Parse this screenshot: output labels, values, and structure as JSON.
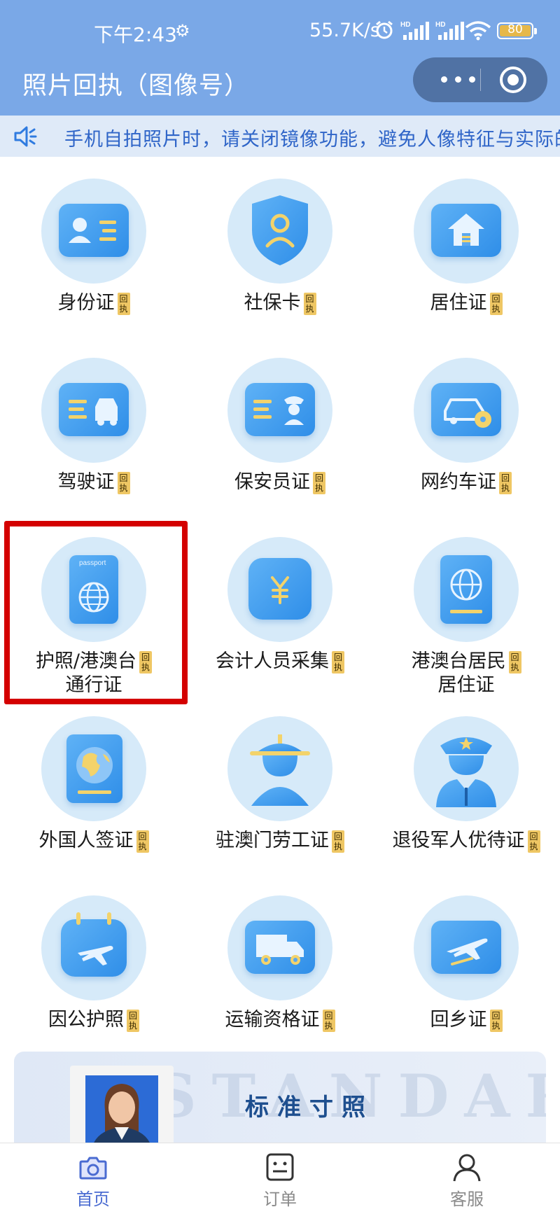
{
  "status_bar": {
    "time": "下午2:43",
    "speed": "55.7K/s",
    "battery": "80"
  },
  "header": {
    "title": "照片回执（图像号）"
  },
  "notice": {
    "text": "手机自拍照片时，请关闭镜像功能，避免人像特征与实际的"
  },
  "badge": {
    "top": "回",
    "bottom": "执"
  },
  "grid": {
    "items": [
      {
        "label": "身份证",
        "icon": "id-card-icon"
      },
      {
        "label": "社保卡",
        "icon": "shield-person-icon"
      },
      {
        "label": "居住证",
        "icon": "house-icon"
      },
      {
        "label": "驾驶证",
        "icon": "driver-license-icon"
      },
      {
        "label": "保安员证",
        "icon": "security-guard-icon"
      },
      {
        "label": "网约车证",
        "icon": "ride-hailing-car-icon"
      },
      {
        "label_line1": "护照/港澳台",
        "label_line2": "通行证",
        "icon": "passport-icon",
        "card_text": "passport"
      },
      {
        "label": "会计人员采集",
        "icon": "yuan-icon"
      },
      {
        "label_line1": "港澳台居民",
        "label_line2": "居住证",
        "icon": "globe-book-icon"
      },
      {
        "label": "外国人签证",
        "icon": "globe-map-icon"
      },
      {
        "label": "驻澳门劳工证",
        "icon": "worker-hat-icon"
      },
      {
        "label": "退役军人优待证",
        "icon": "veteran-cap-icon"
      },
      {
        "label": "因公护照",
        "icon": "calendar-plane-icon"
      },
      {
        "label": "运输资格证",
        "icon": "truck-icon"
      },
      {
        "label": "回乡证",
        "icon": "plane-icon"
      }
    ]
  },
  "banner": {
    "title": "标准寸照",
    "watermark": "STANDARD"
  },
  "tabbar": {
    "tabs": [
      {
        "label": "首页",
        "icon": "camera-icon",
        "active": true
      },
      {
        "label": "订单",
        "icon": "order-list-icon",
        "active": false
      },
      {
        "label": "客服",
        "icon": "person-icon",
        "active": false
      }
    ]
  },
  "colors": {
    "header_bg": "#7aa8e7",
    "notice_text": "#2f65c8",
    "highlight": "#d40000",
    "active_tab": "#4a6bd1"
  }
}
